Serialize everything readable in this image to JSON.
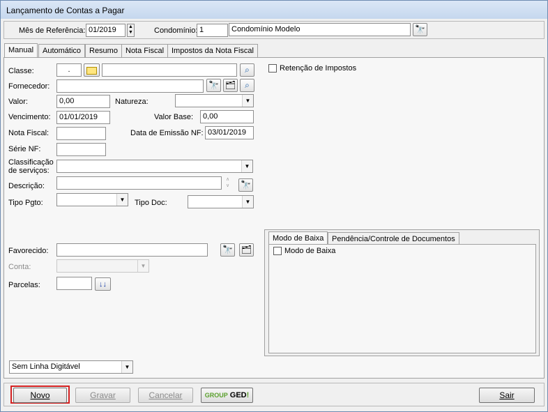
{
  "window": {
    "title": "Lançamento de Contas a Pagar"
  },
  "header": {
    "mes_label": "Mês de Referência:",
    "mes_value": "01/2019",
    "condominio_label": "Condomínio:",
    "condominio_code": "1",
    "condominio_name": "Condomínio Modelo"
  },
  "tabs": [
    "Manual",
    "Automático",
    "Resumo",
    "Nota Fiscal",
    "Impostos da Nota Fiscal"
  ],
  "form": {
    "classe_label": "Classe:",
    "classe_value": ".",
    "retencao_label": "Retenção de Impostos",
    "fornecedor_label": "Fornecedor:",
    "valor_label": "Valor:",
    "valor_value": "0,00",
    "natureza_label": "Natureza:",
    "vencimento_label": "Vencimento:",
    "vencimento_value": "01/01/2019",
    "valor_base_label": "Valor Base:",
    "valor_base_value": "0,00",
    "nota_fiscal_label": "Nota Fiscal:",
    "data_emissao_label": "Data de Emissão NF:",
    "data_emissao_value": "03/01/2019",
    "serie_label": "Série NF:",
    "classificacao_label_1": "Classificação",
    "classificacao_label_2": "de serviços:",
    "descricao_label": "Descrição:",
    "tipo_pgto_label": "Tipo Pgto:",
    "tipo_doc_label": "Tipo Doc:",
    "favorecido_label": "Favorecido:",
    "conta_label": "Conta:",
    "parcelas_label": "Parcelas:",
    "linha_digitavel": "Sem Linha Digitável"
  },
  "baixa": {
    "tabs": [
      "Modo de Baixa",
      "Pendência/Controle de Documentos"
    ],
    "checkbox_label": "Modo de Baixa"
  },
  "buttons": {
    "novo": "Novo",
    "gravar": "Gravar",
    "cancelar": "Cancelar",
    "ged_group": "GROUP",
    "ged_ged": "GED",
    "ged_bang": "!",
    "sair": "Sair"
  },
  "colors": {
    "highlight": "#d42020",
    "ged_green": "#5aa02c"
  }
}
